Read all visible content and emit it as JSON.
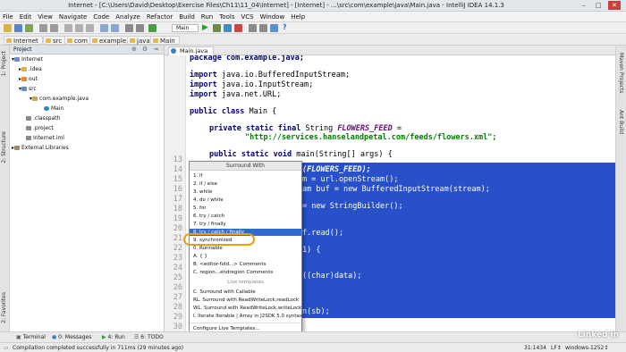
{
  "window": {
    "title": "Internet - [C:\\Users\\David\\Desktop\\Exercise Files\\Ch11\\11_04\\Internet] - [Internet] - ...\\src\\com\\example\\java\\Main.java - IntelliJ IDEA 14.1.3",
    "minimize": "–",
    "maximize": "□",
    "close": "✕"
  },
  "menu": [
    "File",
    "Edit",
    "View",
    "Navigate",
    "Code",
    "Analyze",
    "Refactor",
    "Build",
    "Run",
    "Tools",
    "VCS",
    "Window",
    "Help"
  ],
  "toolbar": {
    "run_config": "Main"
  },
  "breadcrumbs": [
    "Internet",
    "src",
    "com",
    "example",
    "java",
    "Main"
  ],
  "side_tabs": {
    "left_top": "1: Project",
    "left_mid": "2: Structure",
    "left_bottom": "2: Favorites",
    "right_top": "Maven Projects",
    "right_mid": "Ant Build"
  },
  "project_panel": {
    "title": "Project",
    "tree": [
      {
        "label": "Internet",
        "depth": 0,
        "kind": "module"
      },
      {
        "label": ".idea",
        "depth": 1,
        "kind": "folder"
      },
      {
        "label": "out",
        "depth": 1,
        "kind": "folder"
      },
      {
        "label": "src",
        "depth": 1,
        "kind": "folder"
      },
      {
        "label": "com.example.java",
        "depth": 2,
        "kind": "package"
      },
      {
        "label": "Main",
        "depth": 3,
        "kind": "class"
      },
      {
        "label": ".classpath",
        "depth": 1,
        "kind": "file"
      },
      {
        "label": ".project",
        "depth": 1,
        "kind": "file"
      },
      {
        "label": "Internet.iml",
        "depth": 1,
        "kind": "file"
      },
      {
        "label": "External Libraries",
        "depth": 0,
        "kind": "lib"
      }
    ]
  },
  "editor": {
    "tab": "Main.java",
    "line_numbers": [
      "13",
      "14",
      "15",
      "16",
      "17",
      "18",
      "19",
      "20",
      "21",
      "22",
      "23",
      "24",
      "25",
      "26",
      "27",
      "28",
      "29",
      "30",
      "31",
      "32",
      "33",
      "34"
    ],
    "visible_line_numbers": [
      "13",
      "14",
      "15",
      "16",
      "17",
      "18",
      "19",
      "20",
      "21",
      "22",
      "23",
      "24",
      "25",
      "26",
      "27",
      "28",
      "29",
      "30",
      "31",
      "32",
      "33"
    ],
    "code": {
      "l0": "package com.example.java;",
      "l1a": "import",
      "l1b": " java.io.BufferedInputStream;",
      "l2a": "import",
      "l2b": " java.io.InputStream;",
      "l3a": "import",
      "l3b": " java.net.URL;",
      "l4a": "public class",
      "l4b": " Main {",
      "l5a": "private static final",
      "l5b": " String ",
      "l5c": "FLOWERS_FEED",
      "l5d": " =",
      "l6": "\"http://services.hanselandpetal.com/feeds/flowers.xml\";",
      "l7a": "public static void",
      "l7b": " main(String[] args) {",
      "s1": "(FLOWERS_FEED);",
      "s2": "m = url.openStream();",
      "s3": "am buf = new BufferedInputStream(stream);",
      "s4": "= new StringBuilder();",
      "s5": "f.read();",
      "s6": "1) {",
      "s7": "((char)data);",
      "s8": "n(sb);"
    }
  },
  "popup": {
    "title": "Surround With",
    "items": [
      "1. if",
      "2. if / else",
      "3. while",
      "4. do / while",
      "5. for",
      "6. try / catch",
      "7. try / finally",
      "8. try / catch / finally",
      "9. synchronized",
      "0. Runnable",
      "A. { }",
      "B. <editor-fold...> Comments",
      "C. region...endregion Comments"
    ],
    "highlighted_index": 7,
    "live_templates_header": "Live templates",
    "templates": [
      "C. Surround with Callable",
      "RL. Surround with ReadWriteLock.readLock",
      "WL. Surround with ReadWriteLock.writeLock",
      "I. Iterate Iterable | Array in J2SDK 5.0 syntax"
    ],
    "configure": "Configure Live Templates..."
  },
  "bottom_tools": [
    "Terminal",
    "0: Messages",
    "4: Run",
    "6: TODO"
  ],
  "status": {
    "message": "Compilation completed successfully in 711ms (29 minutes ago)",
    "position": "31:1434",
    "separator": "LF↕",
    "encoding": "windows-1252↕"
  },
  "watermark": "Linked in",
  "colors": {
    "selection": "#2750c9",
    "popup_highlight": "#2d6bd1",
    "ring": "#e8a012"
  }
}
